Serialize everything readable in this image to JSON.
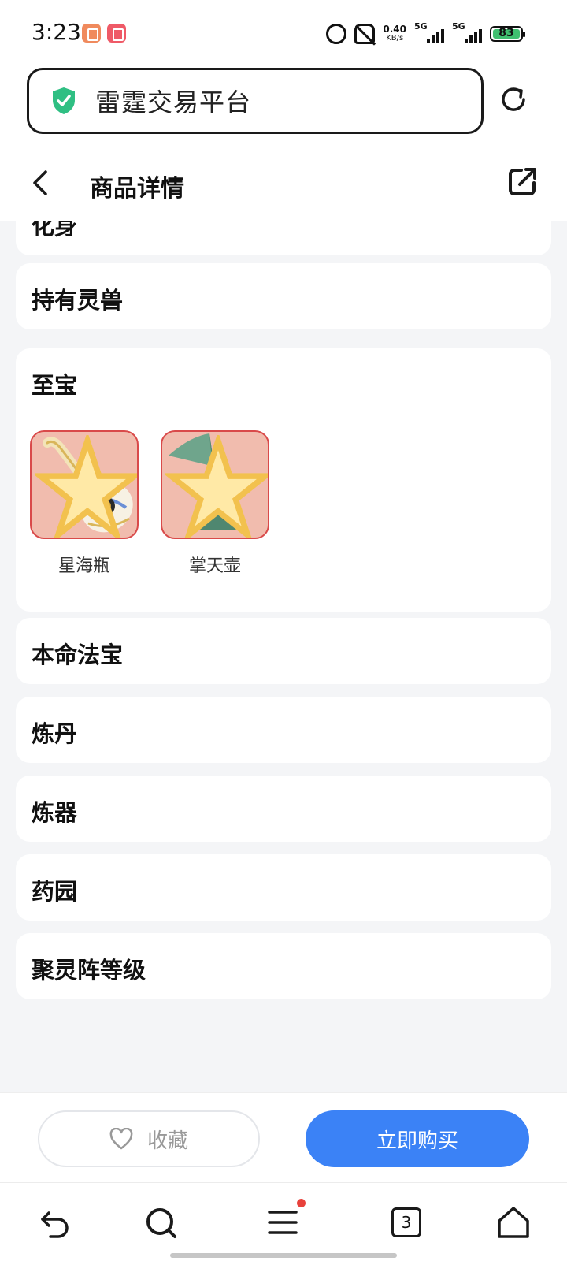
{
  "status_bar": {
    "time": "3:23",
    "net_speed_value": "0.40",
    "net_speed_unit": "KB/s",
    "signal_1": "5G",
    "signal_2": "5G",
    "battery": "83"
  },
  "browser": {
    "address_text": "雷霆交易平台",
    "nav_tabs_count": "3"
  },
  "header": {
    "title": "商品详情"
  },
  "sections": {
    "partial_title": "化身",
    "spirit_beast": "持有灵兽",
    "treasure": "至宝",
    "natal_treasure": "本命法宝",
    "alchemy": "炼丹",
    "refining": "炼器",
    "herb_garden": "药园",
    "spirit_array_level": "聚灵阵等级"
  },
  "treasures": [
    {
      "name": "星海瓶",
      "icon": "star-sea-bottle-icon"
    },
    {
      "name": "掌天壶",
      "icon": "palm-heaven-pot-icon"
    }
  ],
  "actions": {
    "favorite_label": "收藏",
    "buy_label": "立即购买"
  },
  "colors": {
    "accent": "#3b82f6",
    "treasure_bg": "#f1bcae",
    "treasure_border": "#d94a4a",
    "shield": "#2fbf83",
    "badge_red": "#e8413b"
  }
}
